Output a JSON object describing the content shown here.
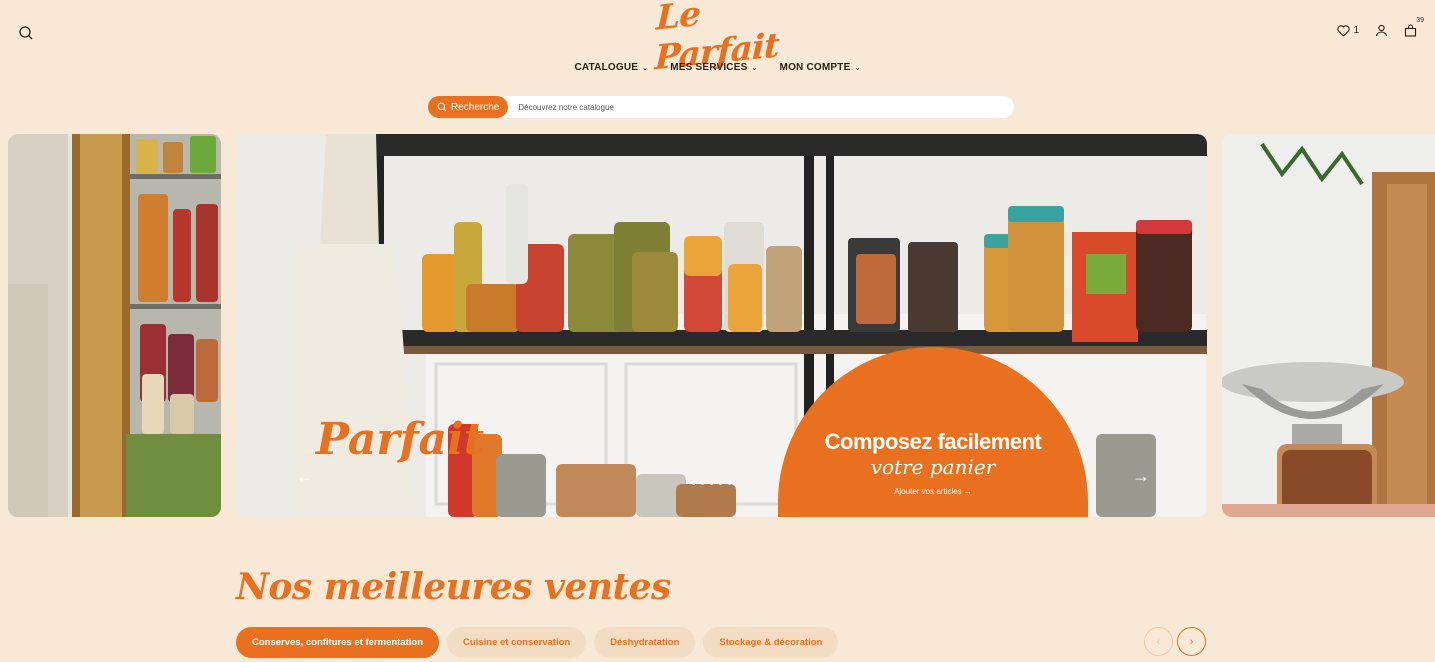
{
  "brand": {
    "logo_text": "Le Parfait",
    "accent": "#e8701e",
    "background": "#f8e8d6"
  },
  "header": {
    "search_icon": "search-icon",
    "nav": [
      {
        "label": "CATALOGUE"
      },
      {
        "label": "MES SERVICES"
      },
      {
        "label": "MON COMPTE"
      }
    ],
    "wishlist_count": "1",
    "cart_count": "39"
  },
  "search": {
    "button_label": "Recherche",
    "placeholder": "Découvrez notre catalogue"
  },
  "hero": {
    "cta_line1": "Composez facilement",
    "cta_line2": "votre panier",
    "cta_link": "Ajouter vos articles →",
    "apron_text": "Parfait",
    "prev_arrow": "←",
    "next_arrow": "→",
    "dots": 5,
    "active_dot": 0
  },
  "best_sellers": {
    "title": "Nos meilleures ventes",
    "tabs": [
      {
        "label": "Conserves, confitures et fermentation",
        "active": true
      },
      {
        "label": "Cuisine et conservation",
        "active": false
      },
      {
        "label": "Déshydratation",
        "active": false
      },
      {
        "label": "Stockage & décoration",
        "active": false
      }
    ],
    "prev_label": "‹",
    "next_label": "›"
  }
}
